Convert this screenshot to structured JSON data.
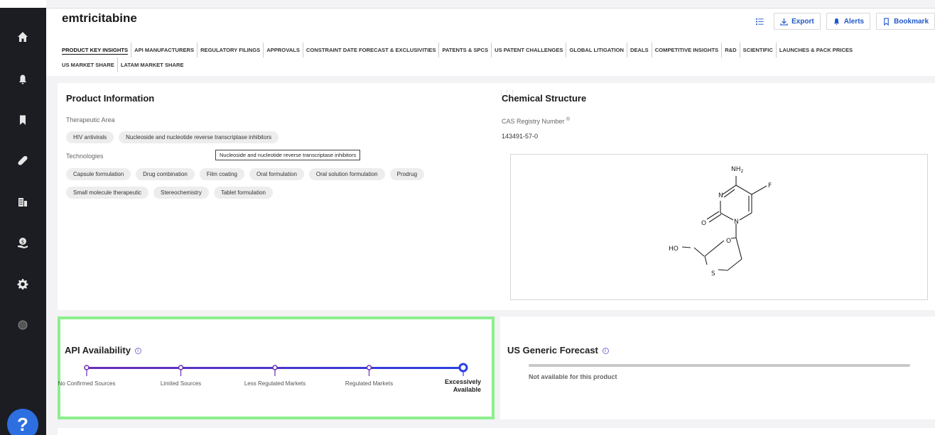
{
  "product": {
    "title": "emtricitabine"
  },
  "header_buttons": {
    "export": "Export",
    "alerts": "Alerts",
    "bookmark": "Bookmark"
  },
  "tabs": [
    "PRODUCT KEY INSIGHTS",
    "API MANUFACTURERS",
    "REGULATORY FILINGS",
    "APPROVALS",
    "CONSTRAINT DATE FORECAST & EXCLUSIVITIES",
    "PATENTS & SPCS",
    "US PATENT CHALLENGES",
    "GLOBAL LITIGATION",
    "DEALS",
    "COMPETITIVE INSIGHTS",
    "R&D",
    "SCIENTIFIC",
    "LAUNCHES & PACK PRICES",
    "US MARKET SHARE",
    "LATAM MARKET SHARE"
  ],
  "product_info": {
    "title": "Product Information",
    "therapeutic_label": "Therapeutic Area",
    "therapeutic": [
      "HIV antivirals",
      "Nucleoside and nucleotide reverse transcriptase inhibitors"
    ],
    "technologies_label": "Technologies",
    "technologies": [
      "Capsule formulation",
      "Drug combination",
      "Film coating",
      "Oral formulation",
      "Oral solution formulation",
      "Prodrug",
      "Small molecule therapeutic",
      "Stereochemistry",
      "Tablet formulation"
    ],
    "tooltip": "Nucleoside and nucleotide reverse transcriptase inhibitors"
  },
  "chemical": {
    "title": "Chemical Structure",
    "cas_label": "CAS Registry Number",
    "cas_sup": "®",
    "cas_value": "143491-57-0",
    "atoms": {
      "nh2": "NH",
      "nh2_sub": "2",
      "f": "F",
      "n1": "N",
      "n2": "N",
      "o_keto": "O",
      "o_ring": "O",
      "ho": "HO",
      "s": "S"
    }
  },
  "api": {
    "title": "API Availability",
    "info": "i",
    "steps": [
      {
        "label": "No Confirmed Sources"
      },
      {
        "label": "Limited Sources"
      },
      {
        "label": "Less Regulated Markets"
      },
      {
        "label": "Regulated Markets"
      },
      {
        "label": "Excessively Available"
      }
    ],
    "selected_index": 4,
    "colors": {
      "start": "#6a2db8",
      "end": "#2a3fe0"
    }
  },
  "forecast": {
    "title": "US Generic Forecast",
    "info": "i",
    "note": "Not available for this product"
  },
  "help": {
    "label": "?"
  }
}
